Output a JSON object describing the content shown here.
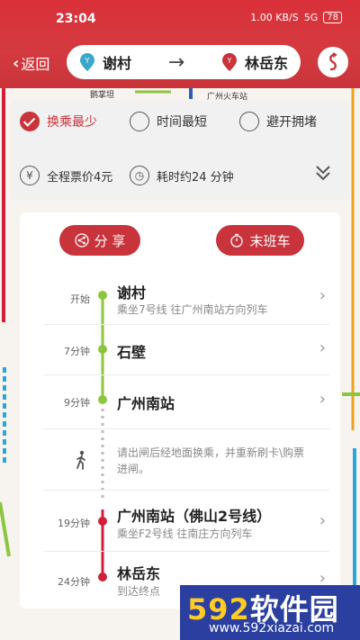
{
  "status": {
    "time": "23:04",
    "net_speed": "1.00 KB/S",
    "signal": "5G",
    "battery": "78"
  },
  "header": {
    "back_label": "返回",
    "from": "谢村",
    "to": "林岳东",
    "arrow": "→"
  },
  "map_labels": [
    "鹅掌坦",
    "广州火车站"
  ],
  "options": [
    {
      "label": "换乘最少",
      "selected": true
    },
    {
      "label": "时间最短",
      "selected": false
    },
    {
      "label": "避开拥堵",
      "selected": false
    }
  ],
  "summary": {
    "fare": "全程票价4元",
    "duration": "耗时约24 分钟"
  },
  "actions": {
    "share": "分 享",
    "last_train": "末班车"
  },
  "steps": [
    {
      "time": "开始",
      "title": "谢村",
      "sub": "乘坐7号线 往广州南站方向列车"
    },
    {
      "time": "7分钟",
      "title": "石壁",
      "sub": ""
    },
    {
      "time": "9分钟",
      "title": "广州南站",
      "sub": ""
    },
    {
      "time": "19分钟",
      "title": "广州南站（佛山2号线）",
      "sub": "乘坐F2号线 往南庄方向列车"
    },
    {
      "time": "24分钟",
      "title": "林岳东",
      "sub": "到达终点"
    }
  ],
  "walk_note": "请出闸后经地面换乘，并重新刷卡\\购票进闸。",
  "watermark": {
    "brand_num": "592",
    "brand_text": "软件园",
    "url": "www.592xiazai.com"
  },
  "colors": {
    "accent": "#c9333b",
    "line7": "#8cc63f",
    "lineF2": "#d11f3a"
  }
}
